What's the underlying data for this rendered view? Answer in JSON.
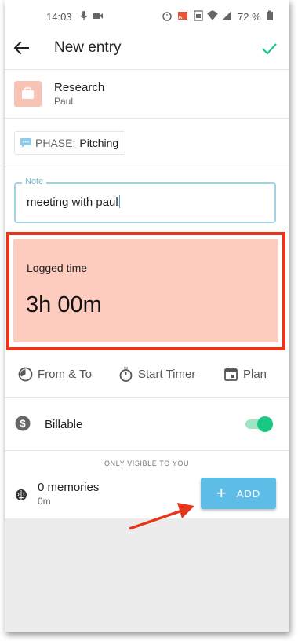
{
  "status_bar": {
    "time": "14:03",
    "battery": "72 %"
  },
  "app_bar": {
    "title": "New entry"
  },
  "project": {
    "name": "Research",
    "client": "Paul",
    "color": "#f7c3b5"
  },
  "phase": {
    "label": "PHASE:",
    "value": "Pitching"
  },
  "note": {
    "label": "Note",
    "value": "meeting with paul"
  },
  "logged_time": {
    "label": "Logged time",
    "value": "3h 00m",
    "background": "#fdccbf"
  },
  "modes": [
    {
      "label": "From & To",
      "icon": "pie-clock-icon"
    },
    {
      "label": "Start Timer",
      "icon": "stopwatch-icon"
    },
    {
      "label": "Plan",
      "icon": "calendar-icon"
    }
  ],
  "billable": {
    "label": "Billable",
    "enabled": true,
    "accent": "#19c983"
  },
  "visibility_note": "ONLY VISIBLE TO YOU",
  "memories": {
    "title": "0 memories",
    "duration": "0m"
  },
  "add_button": {
    "label": "ADD",
    "color": "#5dbde6"
  },
  "annotation": {
    "highlight_color": "#e8361c"
  }
}
